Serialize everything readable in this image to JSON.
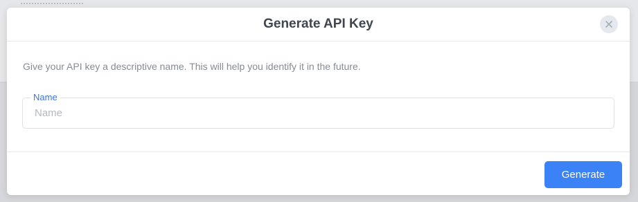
{
  "dialog": {
    "title": "Generate API Key",
    "close_icon": "close-icon",
    "description": "Give your API key a descriptive name. This will help you identify it in the future.",
    "name_field": {
      "label": "Name",
      "placeholder": "Name",
      "value": ""
    },
    "generate_label": "Generate"
  },
  "colors": {
    "accent": "#3b82f6",
    "label_accent": "#3b74e6",
    "title_text": "#40464f",
    "muted_text": "#858b94"
  }
}
